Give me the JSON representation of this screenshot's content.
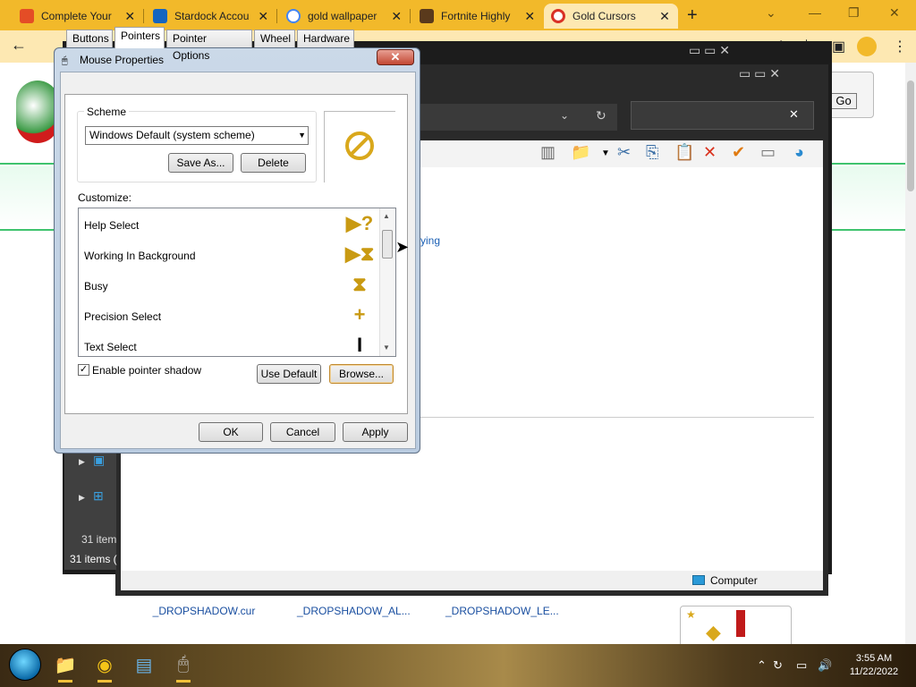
{
  "browser": {
    "tabs": [
      {
        "title": "Complete Your",
        "favicon_color": "#e44d26",
        "active": false
      },
      {
        "title": "Stardock Accou",
        "favicon_color": "#1565c0",
        "active": false
      },
      {
        "title": "gold wallpaper",
        "favicon_color": "#4285f4",
        "active": false
      },
      {
        "title": "Fortnite Highly",
        "favicon_color": "#5a3a1c",
        "active": false
      },
      {
        "title": "Gold Cursors",
        "favicon_color": "#d93025",
        "active": true
      }
    ],
    "new_tab": "+",
    "close_glyph": "✕",
    "window_controls": [
      "⌄",
      "—",
      "❐",
      "✕"
    ]
  },
  "page": {
    "go_button": "Go",
    "files": [
      "_DROPSHADOW.cur",
      "_DROPSHADOW_AL...",
      "_DROPSHADOW_LE..."
    ],
    "partial_text": "ying"
  },
  "explorer": {
    "items_count_1": "31 item",
    "items_count_2": "31 items (",
    "computer_label": "Computer"
  },
  "dialog": {
    "title": "Mouse Properties",
    "close": "✕",
    "tabs": [
      "Buttons",
      "Pointers",
      "Pointer Options",
      "Wheel",
      "Hardware"
    ],
    "active_tab": "Pointers",
    "scheme_label": "Scheme",
    "scheme_value": "Windows Default (system scheme)",
    "save_as": "Save As...",
    "delete": "Delete",
    "customize_label": "Customize:",
    "pointers": [
      {
        "label": "Help Select",
        "icon": "help-select-cursor",
        "glyph": "?"
      },
      {
        "label": "Working In Background",
        "icon": "working-background-cursor",
        "glyph": "⧗"
      },
      {
        "label": "Busy",
        "icon": "busy-hourglass-cursor",
        "glyph": "⧗"
      },
      {
        "label": "Precision Select",
        "icon": "crosshair-cursor",
        "glyph": "+"
      },
      {
        "label": "Text Select",
        "icon": "text-beam-cursor",
        "glyph": "I"
      }
    ],
    "enable_shadow_label": "Enable pointer shadow",
    "enable_shadow_checked": true,
    "use_default": "Use Default",
    "browse": "Browse...",
    "ok": "OK",
    "cancel": "Cancel",
    "apply": "Apply"
  },
  "taskbar": {
    "time": "3:55 AM",
    "date": "11/22/2022"
  },
  "colors": {
    "accent_gold": "#f2b92a",
    "cursor_gold": "#d9a81c"
  }
}
